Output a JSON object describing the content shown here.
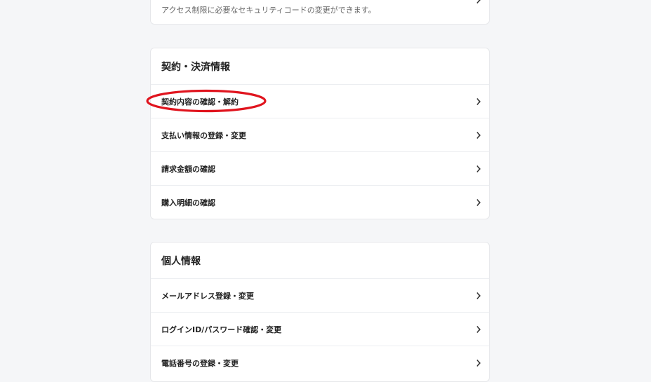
{
  "top_section": {
    "description": "アクセス制限に必要なセキュリティコードの変更ができます。"
  },
  "contract_section": {
    "title": "契約・決済情報",
    "items": [
      {
        "label": "契約内容の確認・解約"
      },
      {
        "label": "支払い情報の登録・変更"
      },
      {
        "label": "請求金額の確認"
      },
      {
        "label": "購入明細の確認"
      }
    ]
  },
  "personal_section": {
    "title": "個人情報",
    "items": [
      {
        "label": "メールアドレス登録・変更"
      },
      {
        "label": "ログインID/パスワード確認・変更"
      },
      {
        "label": "電話番号の登録・変更"
      }
    ]
  },
  "icons": {
    "chevron": "chevron-right-icon"
  },
  "colors": {
    "highlight_annotation": "#e0141e",
    "background": "#f5f6f8",
    "card": "#ffffff"
  }
}
